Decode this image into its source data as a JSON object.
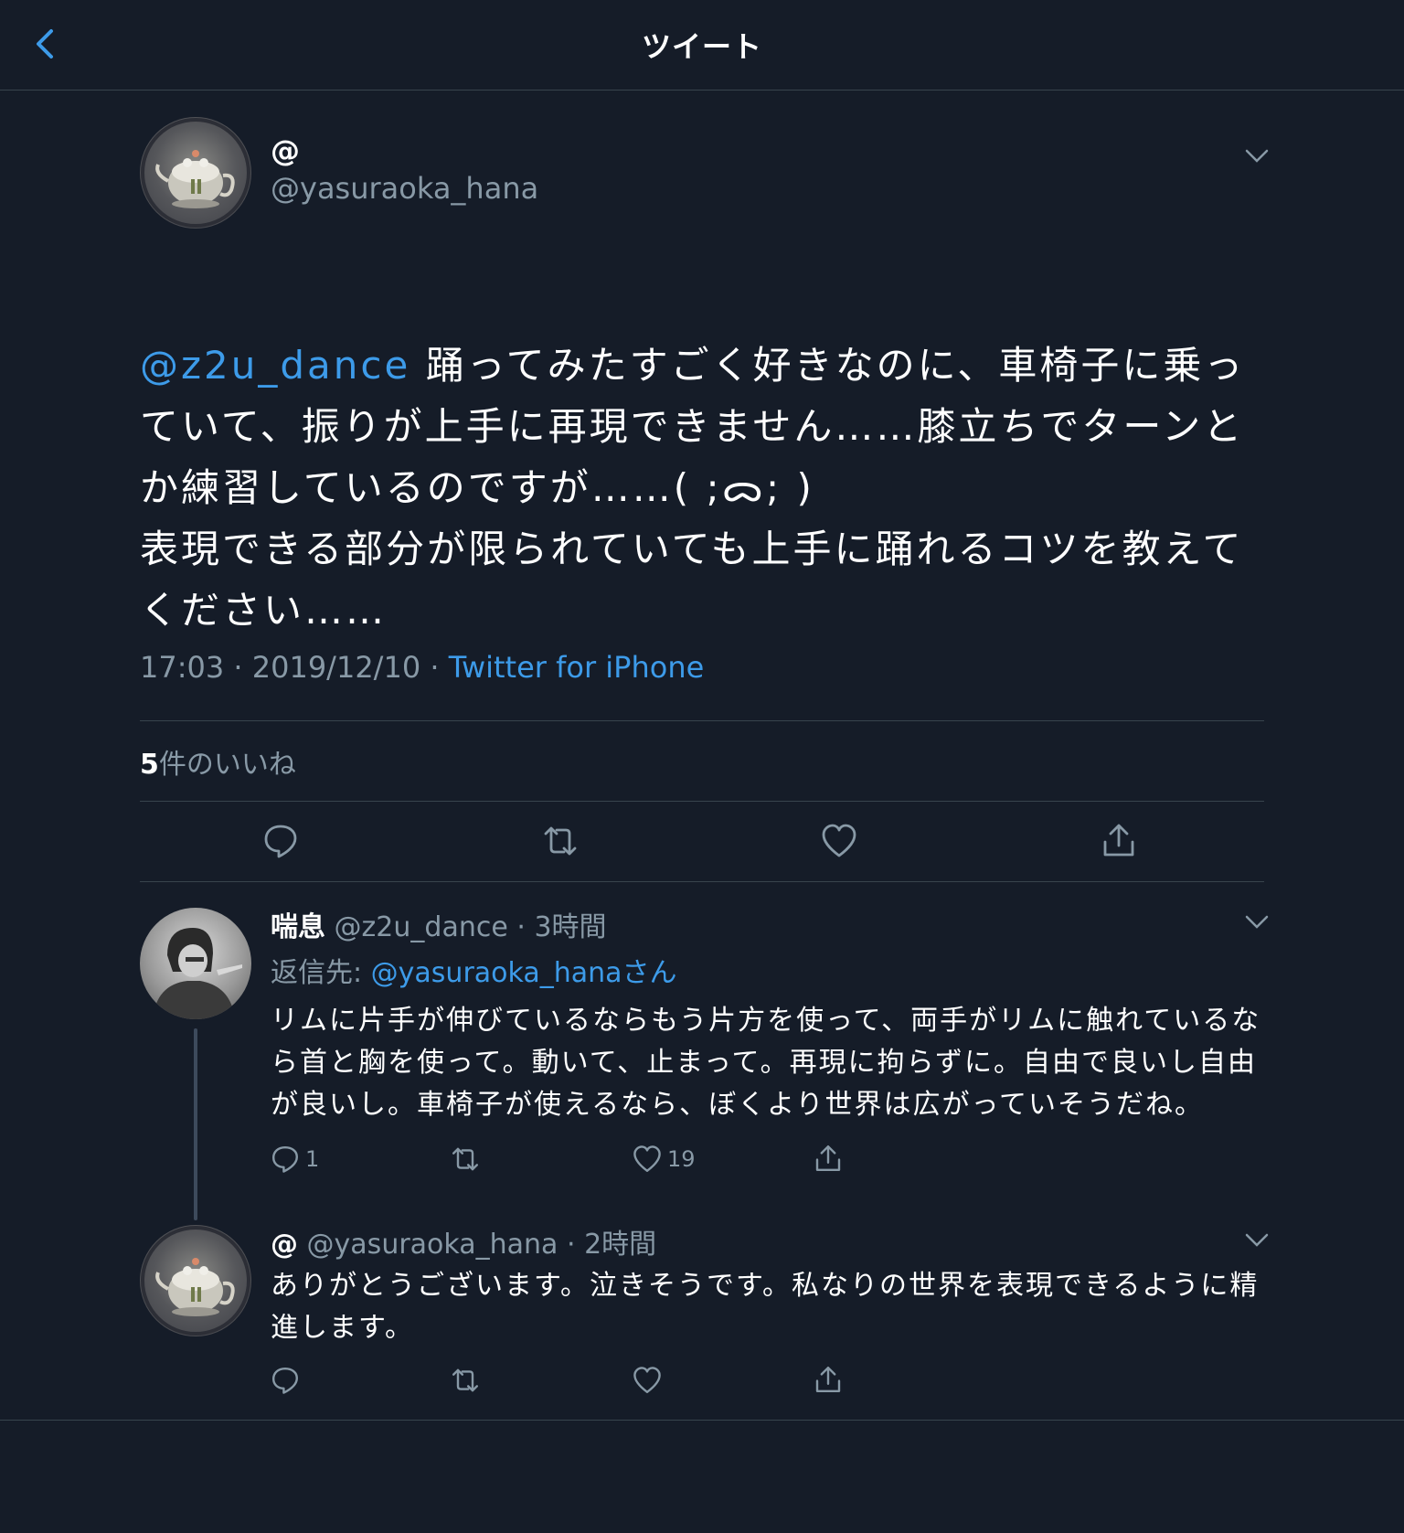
{
  "header": {
    "title": "ツイート",
    "back_icon": "chevron-left-icon"
  },
  "colors": {
    "background": "#151c28",
    "accent": "#3d9be9",
    "muted": "#8899a6",
    "divider": "#38444d"
  },
  "main_tweet": {
    "name": "@",
    "handle": "@yasuraoka_hana",
    "mention": "@z2u_dance",
    "text_1": " 踊ってみたすごく好きなのに、車椅子に乗っていて、振りが上手に再現できません……膝立ちでターンとか練習しているのですが……( ;ᯅ; )",
    "text_2": "表現できる部分が限られていても上手に踊れるコツを教えてください……",
    "time": "17:03",
    "date": "2019/12/10",
    "client": "Twitter for iPhone",
    "likes_count": "5",
    "likes_label": "件のいいね"
  },
  "replies": [
    {
      "name": "喘息",
      "handle": "@z2u_dance",
      "time": "3時間",
      "reply_to_label": "返信先: ",
      "reply_to_link": "@yasuraoka_hanaさん",
      "text": "リムに片手が伸びているならもう片方を使って、両手がリムに触れているなら首と胸を使って。動いて、止まって。再現に拘らずに。自由で良いし自由が良いし。車椅子が使えるなら、ぼくより世界は広がっていそうだね。",
      "reply_count": "1",
      "retweet_count": "",
      "like_count": "19"
    },
    {
      "name": "@",
      "handle": "@yasuraoka_hana",
      "time": "2時間",
      "text": "ありがとうございます。泣きそうです。私なりの世界を表現できるように精進します。",
      "reply_count": "",
      "retweet_count": "",
      "like_count": ""
    }
  ],
  "separator": "·"
}
